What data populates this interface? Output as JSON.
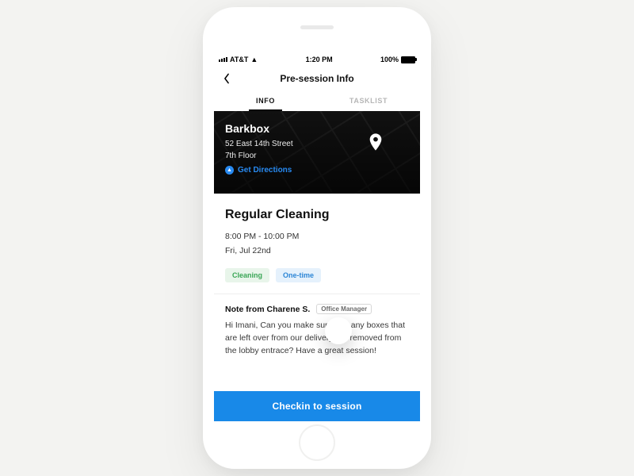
{
  "statusbar": {
    "carrier": "AT&T",
    "time": "1:20 PM",
    "battery": "100%"
  },
  "header": {
    "title": "Pre-session Info"
  },
  "tabs": {
    "info": "INFO",
    "tasklist": "TASKLIST"
  },
  "location": {
    "name": "Barkbox",
    "address_line1": "52 East 14th Street",
    "address_line2": "7th Floor",
    "directions_label": "Get Directions"
  },
  "session": {
    "title": "Regular Cleaning",
    "time_range": "8:00 PM - 10:00 PM",
    "date": "Fri, Jul 22nd",
    "tags": {
      "cleaning": "Cleaning",
      "onetime": "One-time"
    }
  },
  "note": {
    "from_label": "Note from Charene S.",
    "role_badge": "Office Manager",
    "body": "Hi Imani, Can you make sure that any boxes that are left over from our delivery are removed from the lobby entrace? Have a great session!"
  },
  "cta": {
    "label": "Checkin to session"
  }
}
